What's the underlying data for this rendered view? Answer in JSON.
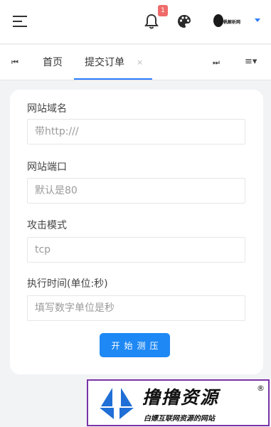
{
  "header": {
    "notification_count": "1",
    "logo_text": "云帆解析网"
  },
  "tabs": {
    "home_label": "首页",
    "active_label": "提交订单",
    "close_symbol": "×"
  },
  "form": {
    "fields": [
      {
        "label": "网站域名",
        "value": "",
        "placeholder": "带http:///"
      },
      {
        "label": "网站端口",
        "value": "",
        "placeholder": "默认是80"
      },
      {
        "label": "攻击模式",
        "value": "tcp",
        "placeholder": ""
      },
      {
        "label": "执行时间(单位:秒)",
        "value": "",
        "placeholder": "填写数字单位是秒"
      }
    ],
    "submit_label": "开始测压"
  },
  "watermark": {
    "title": "撸撸资源",
    "subtitle": "白嫖互联网资源的网站",
    "registered": "®"
  },
  "colors": {
    "accent": "#1e88f5",
    "badge": "#ef6b6b",
    "watermark_border": "#7b33a8"
  },
  "icons": [
    "menu-icon",
    "bell-icon",
    "palette-icon",
    "first-page-icon",
    "last-page-icon",
    "tab-menu-icon"
  ]
}
